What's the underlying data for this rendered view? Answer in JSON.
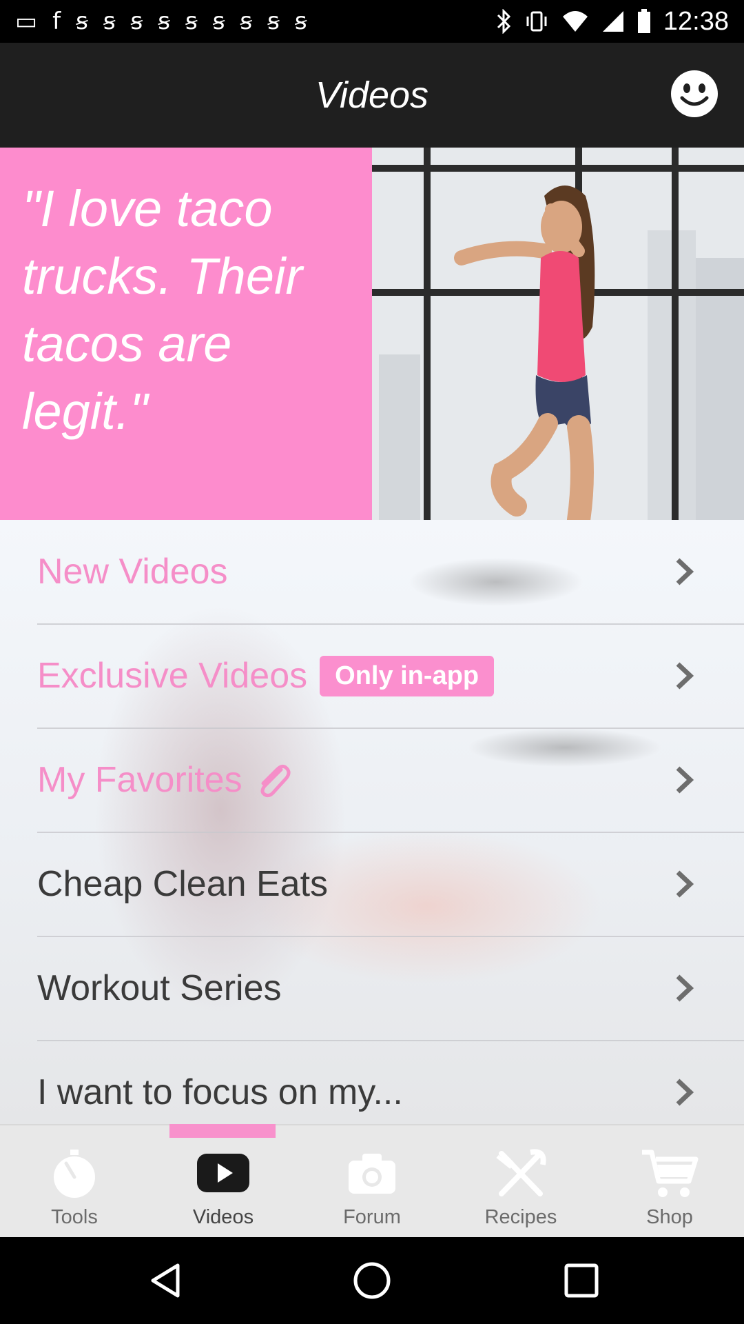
{
  "status_bar": {
    "time": "12:38",
    "left_icons": [
      "messages-icon",
      "facebook-icon",
      "signal-icon",
      "signal-icon",
      "signal-icon",
      "signal-icon",
      "signal-icon",
      "signal-icon",
      "signal-icon",
      "signal-icon",
      "signal-icon"
    ],
    "right_icons": [
      "bluetooth-icon",
      "vibrate-icon",
      "wifi-icon",
      "cell-signal-icon",
      "battery-icon"
    ]
  },
  "header": {
    "title": "Videos",
    "action_icon": "smiley-icon"
  },
  "hero": {
    "quote": "\"I love taco trucks. Their tacos are legit.\"",
    "quote_bg": "#fd8ccd"
  },
  "menu": {
    "items": [
      {
        "label": "New Videos",
        "color": "pink"
      },
      {
        "label": "Exclusive Videos",
        "color": "pink",
        "badge": "Only in-app"
      },
      {
        "label": "My Favorites",
        "color": "pink",
        "icon": "paperclip-icon"
      },
      {
        "label": "Cheap Clean Eats",
        "color": "dark"
      },
      {
        "label": "Workout Series",
        "color": "dark"
      },
      {
        "label": "I want to focus on my...",
        "color": "dark"
      }
    ]
  },
  "tabs": {
    "items": [
      {
        "label": "Tools",
        "icon": "stopwatch-icon"
      },
      {
        "label": "Videos",
        "icon": "play-icon",
        "active": true
      },
      {
        "label": "Forum",
        "icon": "camera-icon"
      },
      {
        "label": "Recipes",
        "icon": "fork-knife-icon"
      },
      {
        "label": "Shop",
        "icon": "cart-icon"
      }
    ],
    "accent": "#f891cc"
  },
  "nav": {
    "buttons": [
      "back-icon",
      "home-icon",
      "recents-icon"
    ]
  }
}
